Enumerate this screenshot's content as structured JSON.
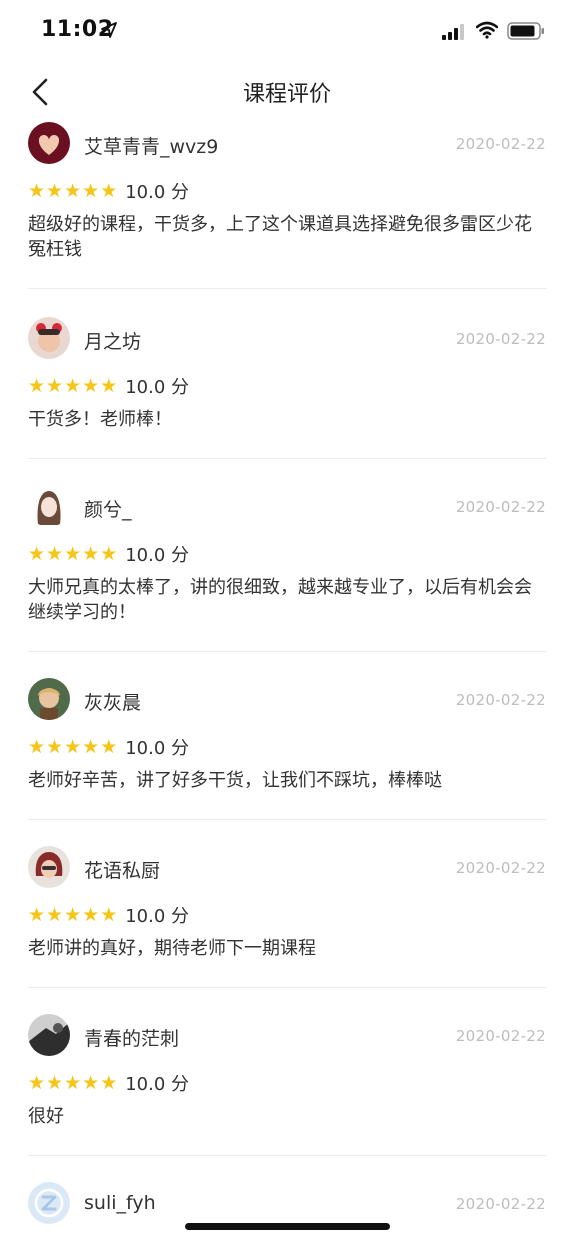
{
  "status_bar": {
    "time": "11:02"
  },
  "nav": {
    "title": "课程评价"
  },
  "reviews": [
    {
      "username": "艾草青青_wvz9",
      "date": "2020-02-22",
      "score": "10.0 分",
      "comment": "超级好的课程，干货多，上了这个课道具选择避免很多雷区少花冤枉钱",
      "avatar_color": "#6b1020"
    },
    {
      "username": "月之坊",
      "date": "2020-02-22",
      "score": "10.0 分",
      "comment": "干货多！老师棒！",
      "avatar_color": "#d77a7a"
    },
    {
      "username": "颜兮_",
      "date": "2020-02-22",
      "score": "10.0 分",
      "comment": "大师兄真的太棒了，讲的很细致，越来越专业了，以后有机会会继续学习的！",
      "avatar_color": "#f1e4dc"
    },
    {
      "username": "灰灰晨",
      "date": "2020-02-22",
      "score": "10.0 分",
      "comment": "老师好辛苦，讲了好多干货，让我们不踩坑，棒棒哒",
      "avatar_color": "#4f6b4a"
    },
    {
      "username": "花语私厨",
      "date": "2020-02-22",
      "score": "10.0 分",
      "comment": "老师讲的真好，期待老师下一期课程",
      "avatar_color": "#7a2d2d"
    },
    {
      "username": "青春的茫刺",
      "date": "2020-02-22",
      "score": "10.0 分",
      "comment": "很好",
      "avatar_color": "#3a3a3a"
    },
    {
      "username": "suli_fyh",
      "date": "2020-02-22",
      "score": "",
      "comment": "",
      "avatar_color": "#c9dff3"
    }
  ]
}
